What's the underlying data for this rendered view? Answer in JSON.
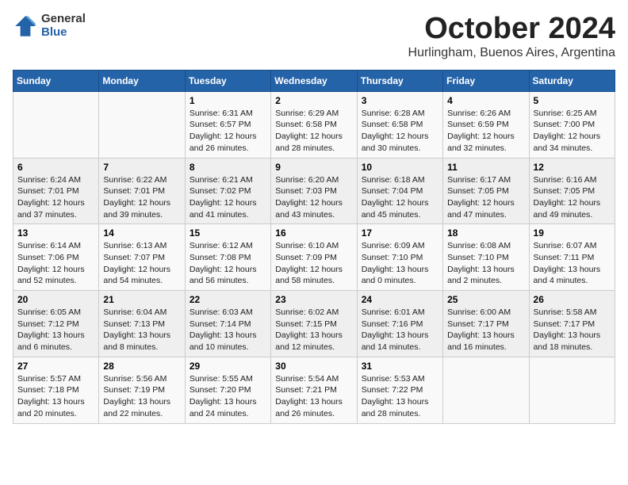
{
  "logo": {
    "general": "General",
    "blue": "Blue"
  },
  "header": {
    "month": "October 2024",
    "location": "Hurlingham, Buenos Aires, Argentina"
  },
  "weekdays": [
    "Sunday",
    "Monday",
    "Tuesday",
    "Wednesday",
    "Thursday",
    "Friday",
    "Saturday"
  ],
  "weeks": [
    [
      {
        "day": null,
        "info": null
      },
      {
        "day": null,
        "info": null
      },
      {
        "day": "1",
        "info": "Sunrise: 6:31 AM\nSunset: 6:57 PM\nDaylight: 12 hours and 26 minutes."
      },
      {
        "day": "2",
        "info": "Sunrise: 6:29 AM\nSunset: 6:58 PM\nDaylight: 12 hours and 28 minutes."
      },
      {
        "day": "3",
        "info": "Sunrise: 6:28 AM\nSunset: 6:58 PM\nDaylight: 12 hours and 30 minutes."
      },
      {
        "day": "4",
        "info": "Sunrise: 6:26 AM\nSunset: 6:59 PM\nDaylight: 12 hours and 32 minutes."
      },
      {
        "day": "5",
        "info": "Sunrise: 6:25 AM\nSunset: 7:00 PM\nDaylight: 12 hours and 34 minutes."
      }
    ],
    [
      {
        "day": "6",
        "info": "Sunrise: 6:24 AM\nSunset: 7:01 PM\nDaylight: 12 hours and 37 minutes."
      },
      {
        "day": "7",
        "info": "Sunrise: 6:22 AM\nSunset: 7:01 PM\nDaylight: 12 hours and 39 minutes."
      },
      {
        "day": "8",
        "info": "Sunrise: 6:21 AM\nSunset: 7:02 PM\nDaylight: 12 hours and 41 minutes."
      },
      {
        "day": "9",
        "info": "Sunrise: 6:20 AM\nSunset: 7:03 PM\nDaylight: 12 hours and 43 minutes."
      },
      {
        "day": "10",
        "info": "Sunrise: 6:18 AM\nSunset: 7:04 PM\nDaylight: 12 hours and 45 minutes."
      },
      {
        "day": "11",
        "info": "Sunrise: 6:17 AM\nSunset: 7:05 PM\nDaylight: 12 hours and 47 minutes."
      },
      {
        "day": "12",
        "info": "Sunrise: 6:16 AM\nSunset: 7:05 PM\nDaylight: 12 hours and 49 minutes."
      }
    ],
    [
      {
        "day": "13",
        "info": "Sunrise: 6:14 AM\nSunset: 7:06 PM\nDaylight: 12 hours and 52 minutes."
      },
      {
        "day": "14",
        "info": "Sunrise: 6:13 AM\nSunset: 7:07 PM\nDaylight: 12 hours and 54 minutes."
      },
      {
        "day": "15",
        "info": "Sunrise: 6:12 AM\nSunset: 7:08 PM\nDaylight: 12 hours and 56 minutes."
      },
      {
        "day": "16",
        "info": "Sunrise: 6:10 AM\nSunset: 7:09 PM\nDaylight: 12 hours and 58 minutes."
      },
      {
        "day": "17",
        "info": "Sunrise: 6:09 AM\nSunset: 7:10 PM\nDaylight: 13 hours and 0 minutes."
      },
      {
        "day": "18",
        "info": "Sunrise: 6:08 AM\nSunset: 7:10 PM\nDaylight: 13 hours and 2 minutes."
      },
      {
        "day": "19",
        "info": "Sunrise: 6:07 AM\nSunset: 7:11 PM\nDaylight: 13 hours and 4 minutes."
      }
    ],
    [
      {
        "day": "20",
        "info": "Sunrise: 6:05 AM\nSunset: 7:12 PM\nDaylight: 13 hours and 6 minutes."
      },
      {
        "day": "21",
        "info": "Sunrise: 6:04 AM\nSunset: 7:13 PM\nDaylight: 13 hours and 8 minutes."
      },
      {
        "day": "22",
        "info": "Sunrise: 6:03 AM\nSunset: 7:14 PM\nDaylight: 13 hours and 10 minutes."
      },
      {
        "day": "23",
        "info": "Sunrise: 6:02 AM\nSunset: 7:15 PM\nDaylight: 13 hours and 12 minutes."
      },
      {
        "day": "24",
        "info": "Sunrise: 6:01 AM\nSunset: 7:16 PM\nDaylight: 13 hours and 14 minutes."
      },
      {
        "day": "25",
        "info": "Sunrise: 6:00 AM\nSunset: 7:17 PM\nDaylight: 13 hours and 16 minutes."
      },
      {
        "day": "26",
        "info": "Sunrise: 5:58 AM\nSunset: 7:17 PM\nDaylight: 13 hours and 18 minutes."
      }
    ],
    [
      {
        "day": "27",
        "info": "Sunrise: 5:57 AM\nSunset: 7:18 PM\nDaylight: 13 hours and 20 minutes."
      },
      {
        "day": "28",
        "info": "Sunrise: 5:56 AM\nSunset: 7:19 PM\nDaylight: 13 hours and 22 minutes."
      },
      {
        "day": "29",
        "info": "Sunrise: 5:55 AM\nSunset: 7:20 PM\nDaylight: 13 hours and 24 minutes."
      },
      {
        "day": "30",
        "info": "Sunrise: 5:54 AM\nSunset: 7:21 PM\nDaylight: 13 hours and 26 minutes."
      },
      {
        "day": "31",
        "info": "Sunrise: 5:53 AM\nSunset: 7:22 PM\nDaylight: 13 hours and 28 minutes."
      },
      {
        "day": null,
        "info": null
      },
      {
        "day": null,
        "info": null
      }
    ]
  ]
}
